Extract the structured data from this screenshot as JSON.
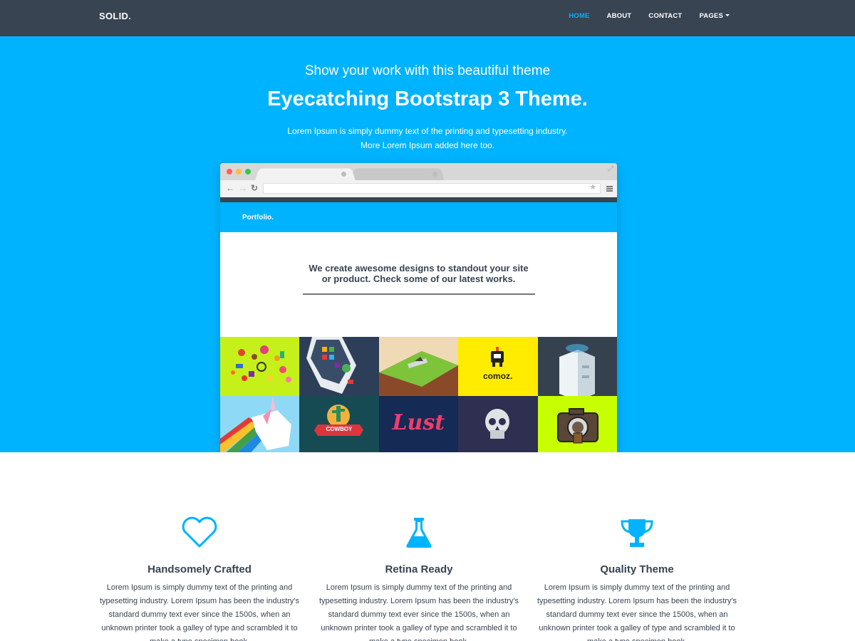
{
  "navbar": {
    "brand": "SOLID.",
    "items": [
      {
        "label": "HOME",
        "active": true
      },
      {
        "label": "ABOUT",
        "active": false
      },
      {
        "label": "CONTACT",
        "active": false
      },
      {
        "label": "PAGES",
        "active": false,
        "dropdown": true
      }
    ]
  },
  "hero": {
    "subtitle": "Show your work with this beautiful theme",
    "title": "Eyecatching Bootstrap 3 Theme.",
    "text_line1": "Lorem Ipsum is simply dummy text of the printing and typesetting industry.",
    "text_line2": "More Lorem Ipsum added here too."
  },
  "mockup": {
    "brand": "Portfolio.",
    "heading_line1": "We create awesome designs to standout your site",
    "heading_line2": "or product. Check some of our latest works.",
    "tiles": [
      {
        "name": "candy-tile",
        "bg": "#c5f01a"
      },
      {
        "name": "phone-tile",
        "bg": "#2c3e58"
      },
      {
        "name": "hill-tile",
        "bg": "#f0d9b5"
      },
      {
        "name": "comoz-tile",
        "bg": "#ffec00",
        "label": "comoz."
      },
      {
        "name": "fridge-tile",
        "bg": "#36414f"
      },
      {
        "name": "unicorn-tile",
        "bg": "#8ed9f6"
      },
      {
        "name": "cowboy-tile",
        "bg": "#174b53",
        "label": "COWBOY"
      },
      {
        "name": "lust-tile",
        "bg": "#152a55",
        "label": "Lust"
      },
      {
        "name": "skull-tile",
        "bg": "#2f2f52"
      },
      {
        "name": "camera-tile",
        "bg": "#c8ff00"
      }
    ]
  },
  "features": [
    {
      "icon": "heart-icon",
      "title": "Handsomely Crafted",
      "text": "Lorem Ipsum is simply dummy text of the printing and typesetting industry. Lorem Ipsum has been the industry's standard dummy text ever since the 1500s, when an unknown printer took a galley of type and scrambled it to make a type specimen book."
    },
    {
      "icon": "flask-icon",
      "title": "Retina Ready",
      "text": "Lorem Ipsum is simply dummy text of the printing and typesetting industry. Lorem Ipsum has been the industry's standard dummy text ever since the 1500s, when an unknown printer took a galley of type and scrambled it to make a type specimen book."
    },
    {
      "icon": "trophy-icon",
      "title": "Quality Theme",
      "text": "Lorem Ipsum is simply dummy text of the printing and typesetting industry. Lorem Ipsum has been the industry's standard dummy text ever since the 1500s, when an unknown printer took a galley of type and scrambled it to make a type specimen book."
    }
  ],
  "colors": {
    "accent": "#00b3fe",
    "navbar": "#384452",
    "text": "#384452"
  }
}
